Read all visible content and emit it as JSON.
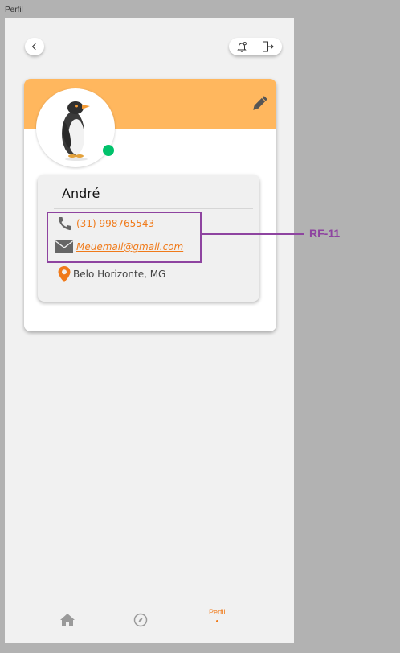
{
  "frame_label": "Perfil",
  "header": {
    "back_icon": "chevron-left-icon",
    "notifications_icon": "bell-icon",
    "logout_icon": "logout-icon"
  },
  "profile": {
    "name": "André",
    "phone": "(31) 998765543",
    "email": "Meuemail@gmail.com",
    "location": "Belo Horizonte, MG",
    "status": "online"
  },
  "annotation": {
    "label": "RF-11"
  },
  "nav": {
    "items": [
      {
        "icon": "home-icon",
        "label": ""
      },
      {
        "icon": "compass-icon",
        "label": ""
      },
      {
        "icon": "",
        "label": "Perfil"
      }
    ]
  },
  "colors": {
    "accent": "#f07a1a",
    "banner": "#ffb75e",
    "status_online": "#00c26b",
    "annotation": "#8e44a0"
  }
}
